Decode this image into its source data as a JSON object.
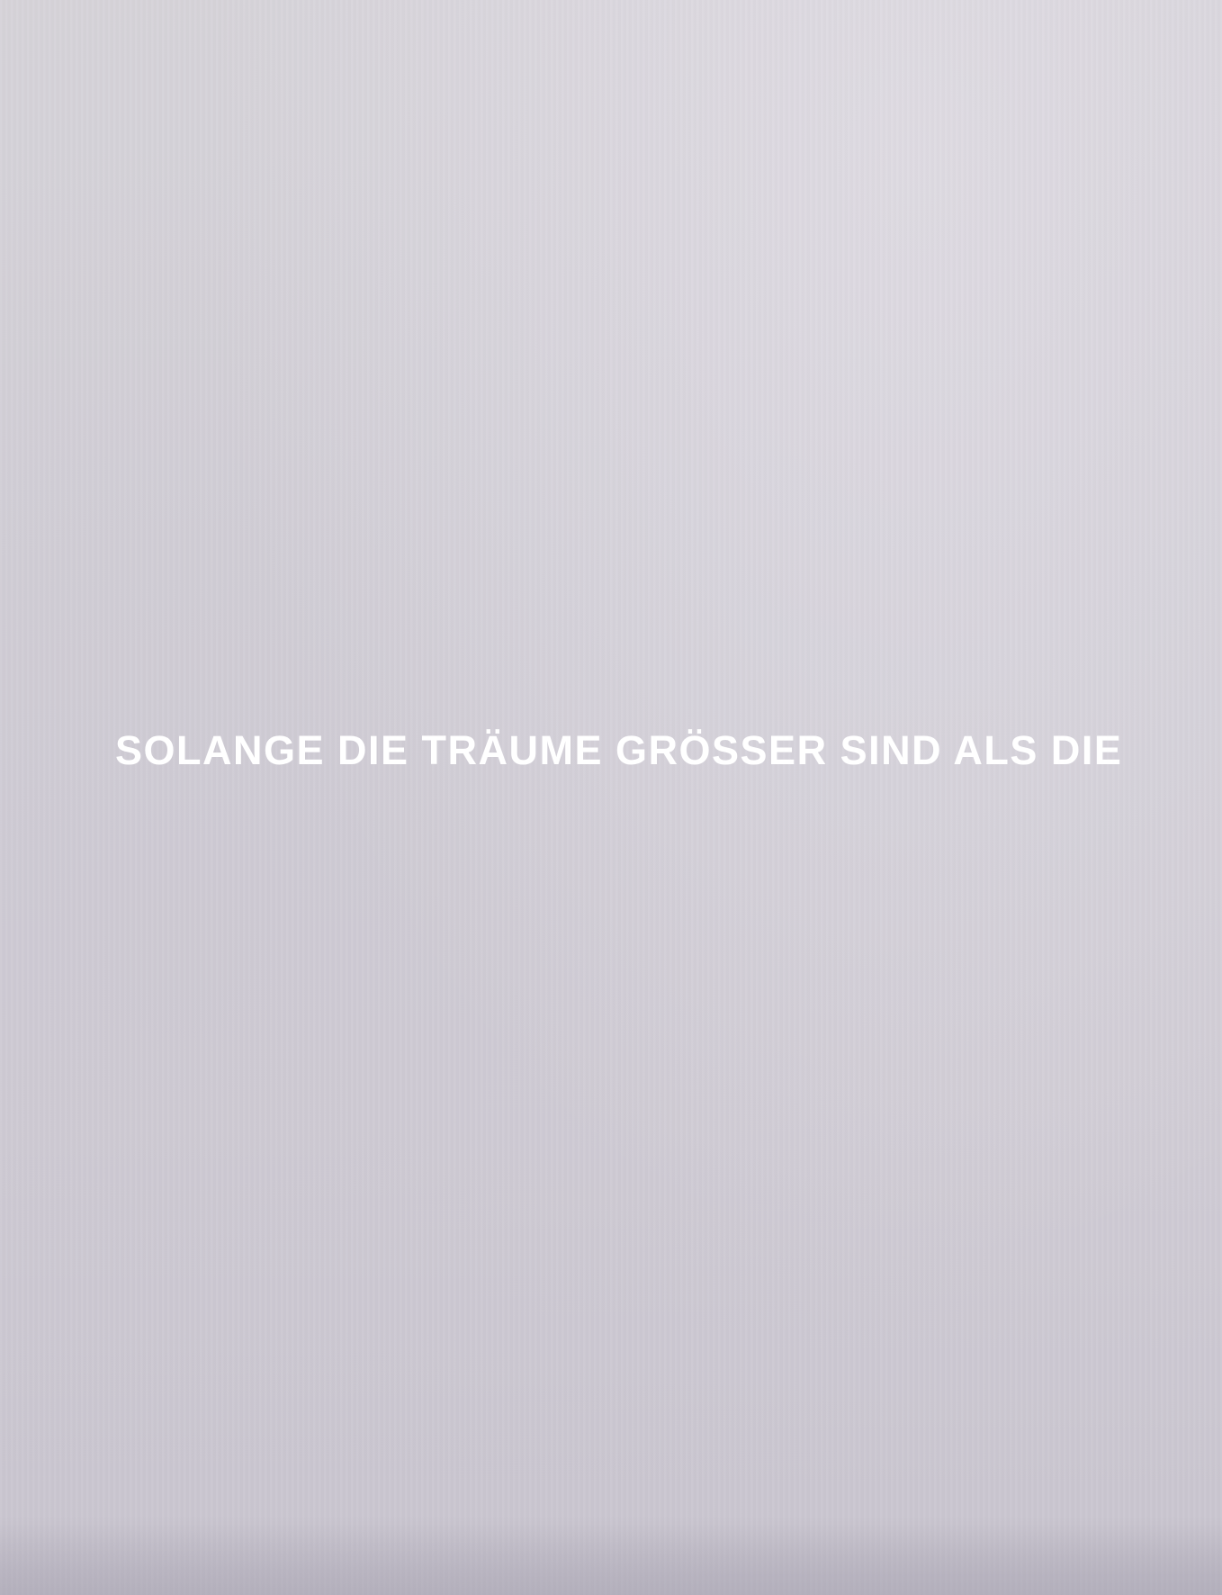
{
  "hero": {
    "headline": "SOLANGE DIE TRÄUME GRÖSSER SIND ALS DIE"
  },
  "colors": {
    "background": "#d2ced6",
    "text": "#ffffff"
  }
}
